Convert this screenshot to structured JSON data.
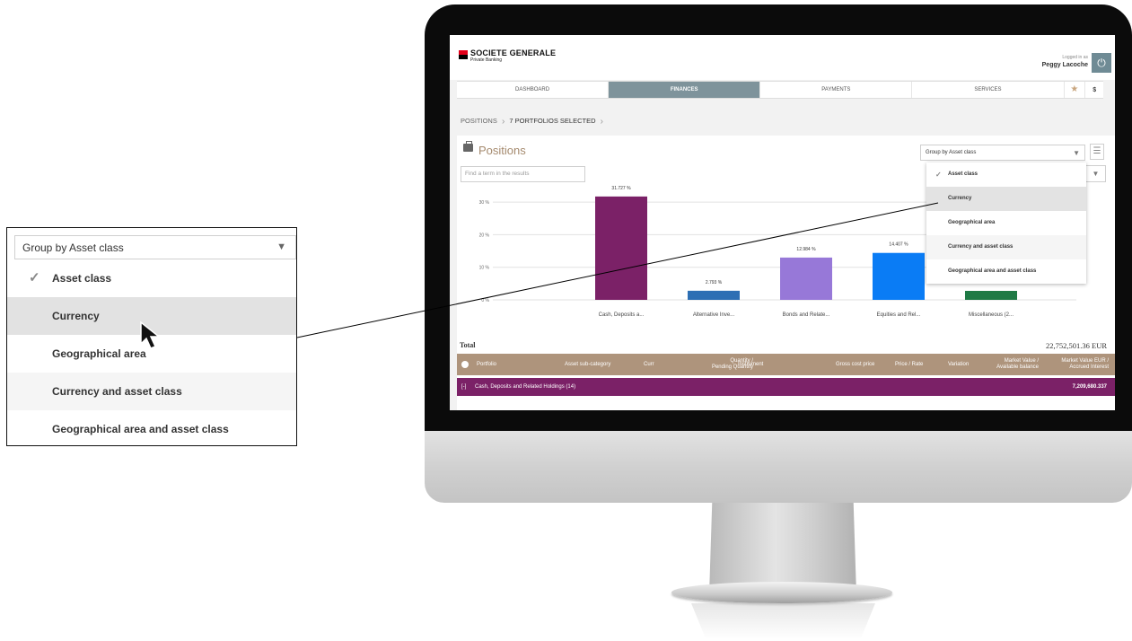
{
  "brand": {
    "name": "SOCIETE GENERALE",
    "subtitle": "Private Banking",
    "logo_colors": [
      "#e2001a",
      "#000000"
    ]
  },
  "user": {
    "logged_label": "Logged in as",
    "name": "Peggy Lacoche"
  },
  "nav": {
    "tabs": [
      {
        "label": "DASHBOARD",
        "active": false
      },
      {
        "label": "FINANCES",
        "active": true
      },
      {
        "label": "PAYMENTS",
        "active": false
      },
      {
        "label": "SERVICES",
        "active": false
      }
    ],
    "dollar_label": "$",
    "star_icon": "star-icon"
  },
  "breadcrumb": {
    "root": "POSITIONS",
    "current": "7 PORTFOLIOS SELECTED"
  },
  "positions": {
    "title": "Positions",
    "search_placeholder": "Find a term in the results",
    "group_by_value": "Group by Asset class",
    "group_options": [
      {
        "label": "Asset class",
        "checked": true,
        "hover": false
      },
      {
        "label": "Currency",
        "checked": false,
        "hover": true
      },
      {
        "label": "Geographical area",
        "checked": false,
        "hover": false
      },
      {
        "label": "Currency and asset class",
        "checked": false,
        "hover": false
      },
      {
        "label": "Geographical area and asset class",
        "checked": false,
        "hover": false
      }
    ]
  },
  "chart_data": {
    "type": "bar",
    "categories": [
      "Cash, Deposits a...",
      "Alternative Inve...",
      "Bonds and Relate...",
      "Equities and Rel...",
      "Miscellaneous (2..."
    ],
    "values": [
      31.727,
      2.793,
      12.984,
      14.407,
      null
    ],
    "value_labels": [
      "31.727 %",
      "2.793 %",
      "12.984 %",
      "14.407 %",
      ""
    ],
    "colors": [
      "#7b2167",
      "#2d6fb4",
      "#9778d8",
      "#0a7cf5",
      "#1f7a45"
    ],
    "ylim": [
      0,
      35
    ],
    "ytick_labels": [
      "0 %",
      "10 %",
      "20 %",
      "30 %"
    ],
    "yticks": [
      0,
      10,
      20,
      30
    ],
    "grid": true
  },
  "summary": {
    "total_label": "Total",
    "total_value": "22,752,501.36 EUR"
  },
  "table": {
    "columns": {
      "portfolio": "Portfolio",
      "sub_category": "Asset sub-category",
      "curr": "Curr",
      "quantity_1": "Quantity /",
      "quantity_2": "Pending Quantity",
      "instrument": "Instrument",
      "gross_cost": "Gross cost price",
      "price_rate": "Price / Rate",
      "variation": "Variation",
      "market_value_1": "Market Value /",
      "market_value_2": "Available balance",
      "mv_eur_1": "Market Value EUR /",
      "mv_eur_2": "Accrued Interest"
    },
    "groups": [
      {
        "toggle": "[-]",
        "name": "Cash, Deposits and Related Holdings (14)",
        "amount": "7,209,680.337"
      }
    ]
  }
}
